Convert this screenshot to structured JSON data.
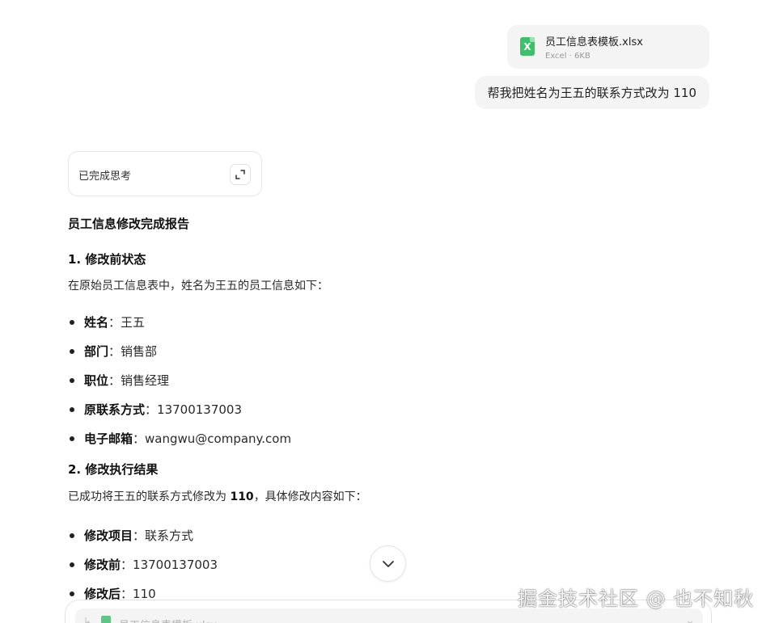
{
  "attachment": {
    "file_name": "员工信息表模板.xlsx",
    "file_meta": "Excel · 6KB",
    "icon": "excel-file-icon",
    "icon_letter": "X",
    "icon_color": "#3fbf6a"
  },
  "user_message": "帮我把姓名为王五的联系方式改为 110",
  "thinking": {
    "label": "已完成思考",
    "expand_icon": "expand-icon"
  },
  "report": {
    "title": "员工信息修改完成报告",
    "section1": {
      "heading": "1. 修改前状态",
      "intro": "在原始员工信息表中，姓名为王五的员工信息如下：",
      "items": [
        {
          "key": "姓名",
          "sep": "：",
          "value": "王五"
        },
        {
          "key": "部门",
          "sep": "：",
          "value": "销售部"
        },
        {
          "key": "职位",
          "sep": "：",
          "value": "销售经理"
        },
        {
          "key": "原联系方式",
          "sep": "：",
          "value": "13700137003"
        },
        {
          "key": "电子邮箱",
          "sep": "：",
          "value": "wangwu@company.com"
        }
      ]
    },
    "section2": {
      "heading": "2. 修改执行结果",
      "intro_before": "已成功将王五的联系方式修改为 ",
      "intro_bold": "110",
      "intro_after": "，具体修改内容如下：",
      "items": [
        {
          "key": "修改项目",
          "sep": "：",
          "value": "联系方式"
        },
        {
          "key": "修改前",
          "sep": "：",
          "value": "13700137003"
        },
        {
          "key": "修改后",
          "sep": "：",
          "value": "110"
        }
      ]
    }
  },
  "scroll_down_icon": "chevron-down-icon",
  "composer": {
    "attachment_name": "员工信息表模板.xlsx",
    "arrow_icon": "reply-arrow-icon",
    "close_icon": "chevron-down-icon"
  },
  "watermark": "掘金技术社区 @ 也不知秋"
}
